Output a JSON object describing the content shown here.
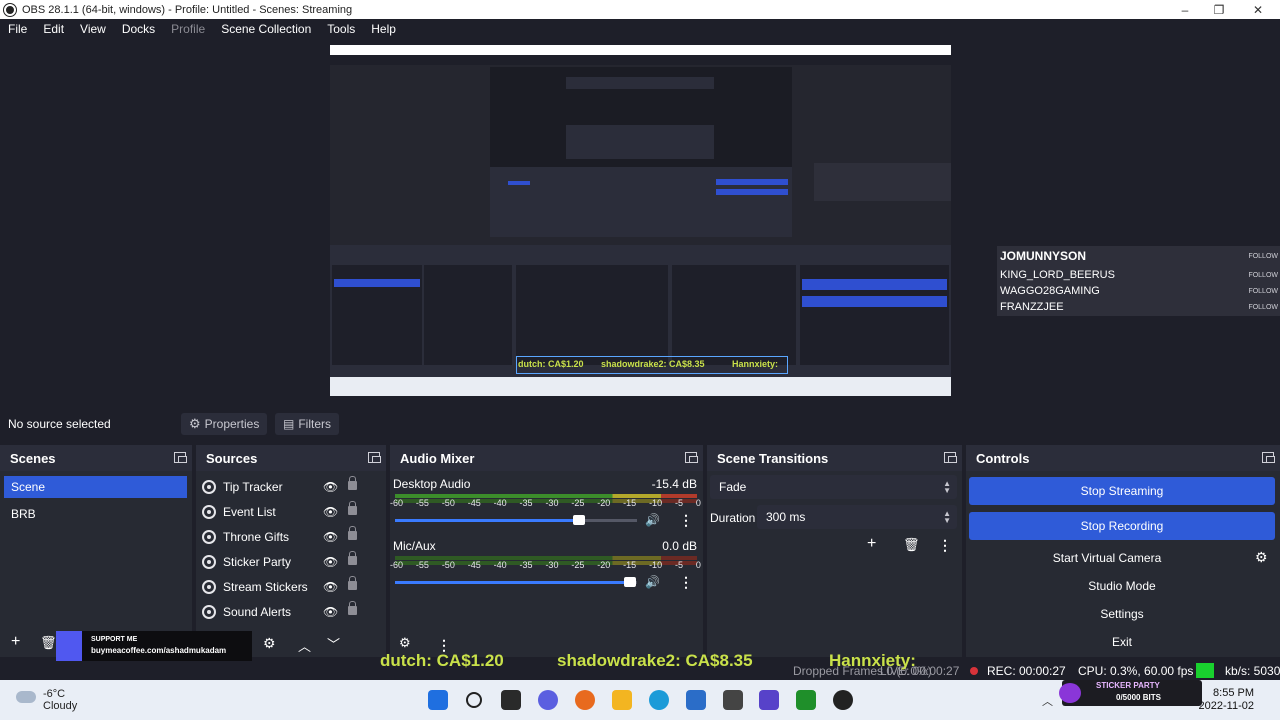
{
  "window": {
    "title": "OBS 28.1.1 (64-bit, windows) - Profile: Untitled - Scenes: Streaming",
    "controls": [
      "–",
      "❐",
      "✕"
    ]
  },
  "menu": [
    "File",
    "Edit",
    "View",
    "Docks",
    "Profile",
    "Scene Collection",
    "Tools",
    "Help"
  ],
  "preview": {
    "ticker_items": [
      "dutch: CA$1.20",
      "shadowdrake2: CA$8.35",
      "Hannxiety:"
    ]
  },
  "chat_widget": {
    "follow_label": "FOLLOW",
    "users": [
      "JOMUNNYSON",
      "KING_LORD_BEERUS",
      "WAGGO28GAMING",
      "FRANZZJEE"
    ]
  },
  "source_bar": {
    "no_source": "No source selected",
    "properties": "Properties",
    "filters": "Filters"
  },
  "scenes": {
    "title": "Scenes",
    "items": [
      "Scene",
      "BRB"
    ],
    "selected": "Scene"
  },
  "sources": {
    "title": "Sources",
    "items": [
      "Tip Tracker",
      "Event List",
      "Throne Gifts",
      "Sticker Party",
      "Stream Stickers",
      "Sound Alerts"
    ]
  },
  "audio_mixer": {
    "title": "Audio Mixer",
    "ticks": [
      "-60",
      "-55",
      "-50",
      "-45",
      "-40",
      "-35",
      "-30",
      "-25",
      "-20",
      "-15",
      "-10",
      "-5",
      "0"
    ],
    "channels": [
      {
        "name": "Desktop Audio",
        "db": "-15.4 dB",
        "volume_fraction": 0.76
      },
      {
        "name": "Mic/Aux",
        "db": "0.0 dB",
        "volume_fraction": 0.97
      }
    ]
  },
  "transitions": {
    "title": "Scene Transitions",
    "type": "Fade",
    "duration_label": "Duration",
    "duration_value": "300 ms"
  },
  "controls": {
    "title": "Controls",
    "stop_streaming": "Stop Streaming",
    "stop_recording": "Stop Recording",
    "start_virtual_camera": "Start Virtual Camera",
    "studio_mode": "Studio Mode",
    "settings": "Settings",
    "exit": "Exit"
  },
  "ticker": [
    "dutch: CA$1.20",
    "shadowdrake2: CA$8.35",
    "Hannxiety:"
  ],
  "status": {
    "dropped": "Dropped Frames 0 (0.0%)",
    "live": "LIVE: 00:00:27",
    "rec": "REC: 00:00:27",
    "cpu": "CPU: 0.3%, 60.00 fps",
    "kbs": "kb/s: 5030"
  },
  "support_widget": {
    "line1": "SUPPORT ME",
    "line2": "buymeacoffee.com/ashadmukadam"
  },
  "sticker_widget": {
    "line1": "STICKER PARTY",
    "line2": "0/5000 BITS"
  },
  "taskbar": {
    "temperature": "-6°C",
    "condition": "Cloudy",
    "time": "8:55 PM",
    "date": "2022-11-02"
  },
  "colors": {
    "accent": "#2f5bd8",
    "background": "#1e1f29",
    "dock": "#272a33",
    "ticker": "#c9e14a"
  }
}
